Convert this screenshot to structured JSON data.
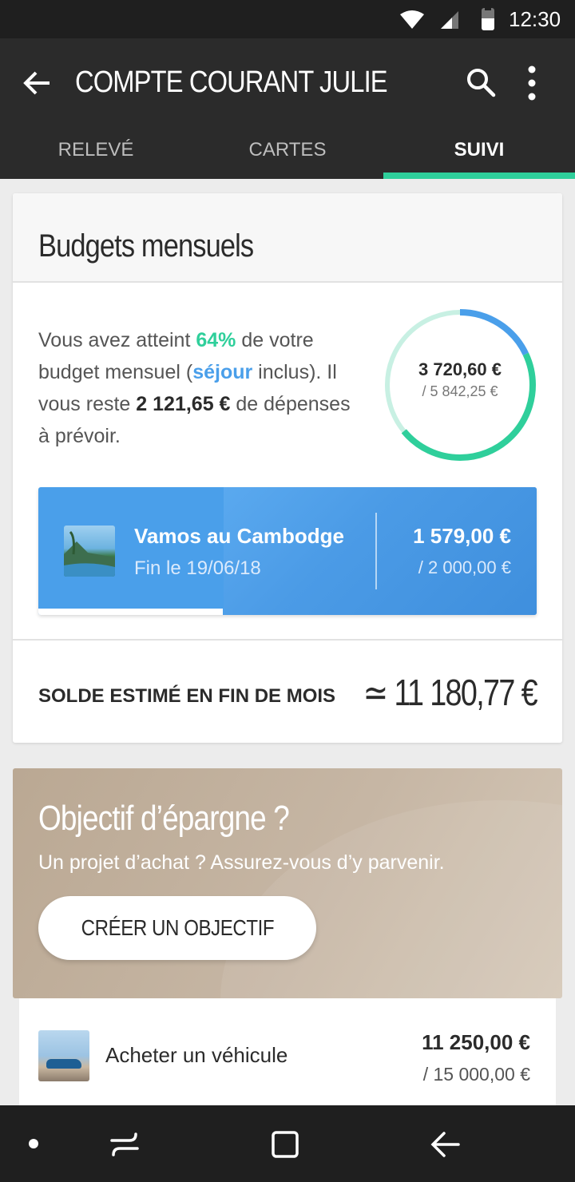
{
  "status_bar": {
    "time": "12:30",
    "battery_level": 0.55
  },
  "app_bar": {
    "title": "COMPTE COURANT JULIE",
    "icons": [
      "back-arrow-icon",
      "search-icon",
      "more-vert-icon"
    ],
    "tabs": [
      {
        "label": "RELEVÉ",
        "active": false
      },
      {
        "label": "CARTES",
        "active": false
      },
      {
        "label": "SUIVI",
        "active": true
      }
    ]
  },
  "budget": {
    "title": "Budgets mensuels",
    "summary": {
      "p1": "Vous avez atteint ",
      "percent": "64%",
      "p2": " de votre budget mensuel (",
      "category": "séjour",
      "p3": " inclus). Il vous reste ",
      "remaining": "2 121,65 €",
      "p4": " de dépenses à prévoir."
    },
    "ring": {
      "spent": "3 720,60 €",
      "total": "/ 5 842,25 €",
      "progress": 0.64,
      "colors": {
        "progress_green": "#2fcf9b",
        "progress_blue": "#4a9fea",
        "track": "#c8f0e3"
      }
    },
    "trip": {
      "name": "Vamos au Cambodge",
      "end_date": "Fin le 19/06/18",
      "spent": "1 579,00 €",
      "cap": "/ 2 000,00 €",
      "progress": 0.37,
      "color": "#4a9fea"
    },
    "estimated_balance": {
      "label": "SOLDE ESTIMÉ EN FIN DE MOIS",
      "value": "≃ 11 180,77 €"
    }
  },
  "savings_promo": {
    "title": "Objectif d’épargne ?",
    "subtitle": "Un projet d’achat ? Assurez-vous d’y parvenir.",
    "cta_label": "CRÉER UN OBJECTIF",
    "color": "#c2b19e"
  },
  "goals": [
    {
      "name": "Acheter un véhicule",
      "amount": "11 250,00 €",
      "target": "/ 15 000,00 €"
    }
  ],
  "nav_bar": {
    "icons": [
      "dot-icon",
      "recents-icon",
      "home-square-icon",
      "back-icon"
    ]
  }
}
